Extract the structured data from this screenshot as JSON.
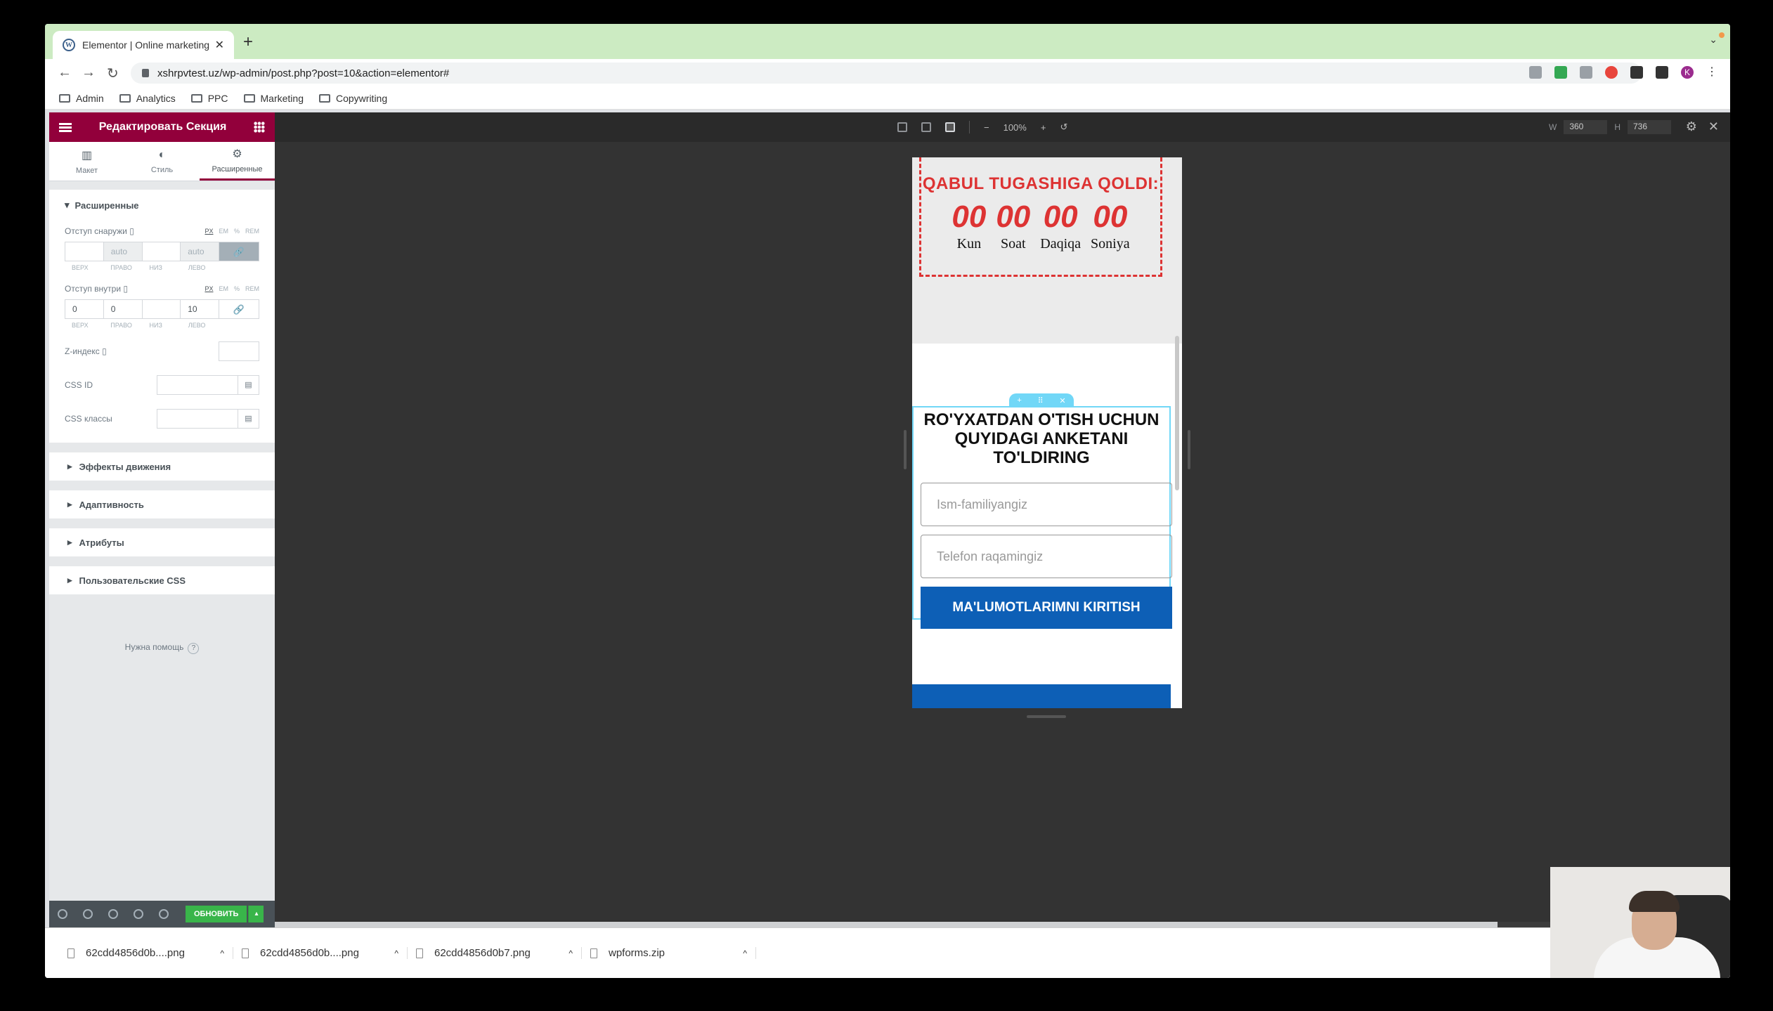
{
  "browser": {
    "tab_title": "Elementor | Online marketing k",
    "new_tab": "+",
    "url": "xshrpvtest.uz/wp-admin/post.php?post=10&action=elementor#",
    "profile_initial": "K",
    "bookmarks": [
      "Admin",
      "Analytics",
      "PPC",
      "Marketing",
      "Copywriting"
    ]
  },
  "sidebar": {
    "header_title": "Редактировать Секция",
    "tabs": [
      {
        "label": "Макет",
        "icon": "layout-icon"
      },
      {
        "label": "Стиль",
        "icon": "style-icon"
      },
      {
        "label": "Расширенные",
        "icon": "gear-icon"
      }
    ],
    "section_title": "Расширенные",
    "margin": {
      "label": "Отступ снаружи",
      "units": [
        "PX",
        "EM",
        "%",
        "REM"
      ],
      "values": [
        "",
        "auto",
        "",
        "auto"
      ],
      "sublabels": [
        "ВЕРХ",
        "ПРАВО",
        "НИЗ",
        "ЛЕВО"
      ]
    },
    "padding": {
      "label": "Отступ внутри",
      "units": [
        "PX",
        "EM",
        "%",
        "REM"
      ],
      "values": [
        "0",
        "0",
        "",
        "10"
      ],
      "sublabels": [
        "ВЕРХ",
        "ПРАВО",
        "НИЗ",
        "ЛЕВО"
      ]
    },
    "z_index_label": "Z-индекс",
    "css_id_label": "CSS ID",
    "css_classes_label": "CSS классы",
    "collapsed_sections": [
      "Эффекты движения",
      "Адаптивность",
      "Атрибуты",
      "Пользовательские CSS"
    ],
    "help_text": "Нужна помощь",
    "update_label": "ОБНОВИТЬ"
  },
  "toolbar": {
    "zoom": "100%",
    "width_label": "W",
    "width_value": "360",
    "height_label": "H",
    "height_value": "736"
  },
  "preview": {
    "timer_title": "QABUL TUGASHIGA QOLDI:",
    "timer": [
      {
        "value": "00",
        "label": "Kun"
      },
      {
        "value": "00",
        "label": "Soat"
      },
      {
        "value": "00",
        "label": "Daqiqa"
      },
      {
        "value": "00",
        "label": "Soniya"
      }
    ],
    "form_title": "RO'YXATDAN O'TISH UCHUN QUYIDAGI ANKETANI TO'LDIRING",
    "name_placeholder": "Ism-familiyangiz",
    "phone_placeholder": "Telefon raqamingiz",
    "submit_label": "MA'LUMOTLARIMNI KIRITISH"
  },
  "downloads": [
    {
      "name": "62cdd4856d0b....png"
    },
    {
      "name": "62cdd4856d0b....png"
    },
    {
      "name": "62cdd4856d0b7.png"
    },
    {
      "name": "wpforms.zip"
    }
  ],
  "colors": {
    "elementor_brand": "#92003b",
    "timer_red": "#dd3333",
    "submit_blue": "#0d5fb6",
    "update_green": "#39b54a"
  }
}
